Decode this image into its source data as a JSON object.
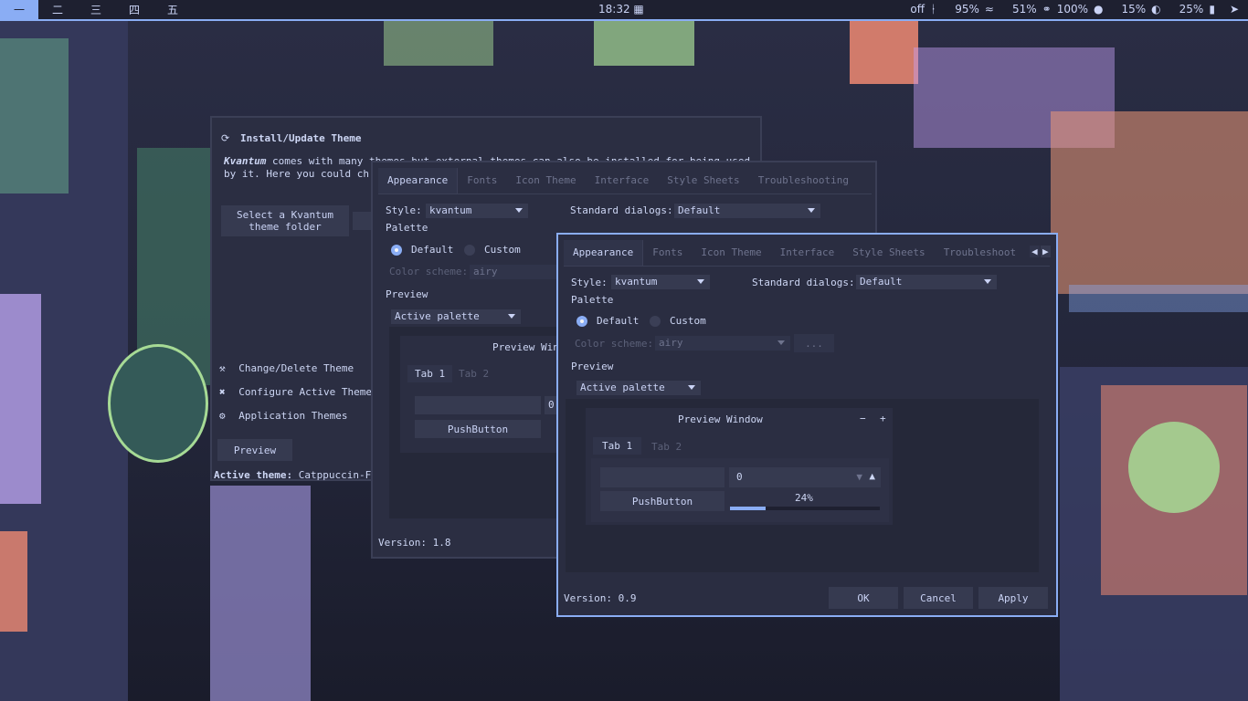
{
  "topbar": {
    "workspaces": [
      "一",
      "二",
      "三",
      "四",
      "五"
    ],
    "clock": "18:32",
    "tray": {
      "bluetooth": "off",
      "wifi": "95%",
      "headphones": "51%",
      "mic": "100%",
      "brightness": "15%",
      "battery": "25%"
    }
  },
  "install_window": {
    "title": "Install/Update Theme",
    "desc_brand": "Kvantum",
    "desc_line1": " comes with many themes but external themes can also be installed for being used",
    "desc_line2": "by it. Here you could ch",
    "select_button": "Select a Kvantum theme folder",
    "nav": [
      {
        "label": "Change/Delete Theme",
        "icon": "tools-icon"
      },
      {
        "label": "Configure Active Theme",
        "icon": "wrench-icon"
      },
      {
        "label": "Application Themes",
        "icon": "gear-icon"
      }
    ],
    "preview_button": "Preview",
    "active_label": "Active theme:",
    "active_value": "Catppuccin-F"
  },
  "middle_window": {
    "tabs": [
      "Appearance",
      "Fonts",
      "Icon Theme",
      "Interface",
      "Style Sheets",
      "Troubleshooting"
    ],
    "style_label": "Style:",
    "style_value": "kvantum",
    "std_label": "Standard dialogs:",
    "std_value": "Default",
    "palette": "Palette",
    "default": "Default",
    "custom": "Custom",
    "scheme_label": "Color scheme:",
    "scheme_value": "airy",
    "preview": "Preview",
    "active_palette": "Active palette",
    "preview_window": "Preview Win",
    "tab1": "Tab 1",
    "tab2": "Tab 2",
    "pushbutton": "PushButton",
    "spin_fragment": "0",
    "version": "Version: 1.8"
  },
  "front_window": {
    "tabs": [
      "Appearance",
      "Fonts",
      "Icon Theme",
      "Interface",
      "Style Sheets",
      "Troubleshoot"
    ],
    "style_label": "Style:",
    "style_value": "kvantum",
    "std_label": "Standard dialogs:",
    "std_value": "Default",
    "palette": "Palette",
    "default": "Default",
    "custom": "Custom",
    "scheme_label": "Color scheme:",
    "scheme_value": "airy",
    "scheme_more": "...",
    "preview": "Preview",
    "active_palette": "Active palette",
    "preview_window": "Preview Window",
    "minus": "−",
    "plus": "+",
    "tab1": "Tab 1",
    "tab2": "Tab 2",
    "spin_value": "0",
    "pushbutton": "PushButton",
    "progress_text": "24%",
    "progress_fraction": 0.24,
    "version": "Version: 0.9",
    "ok": "OK",
    "cancel": "Cancel",
    "apply": "Apply"
  },
  "colors": {
    "accent": "#8aadf4",
    "background": "#2a2d41",
    "text": "#cad3f5"
  }
}
